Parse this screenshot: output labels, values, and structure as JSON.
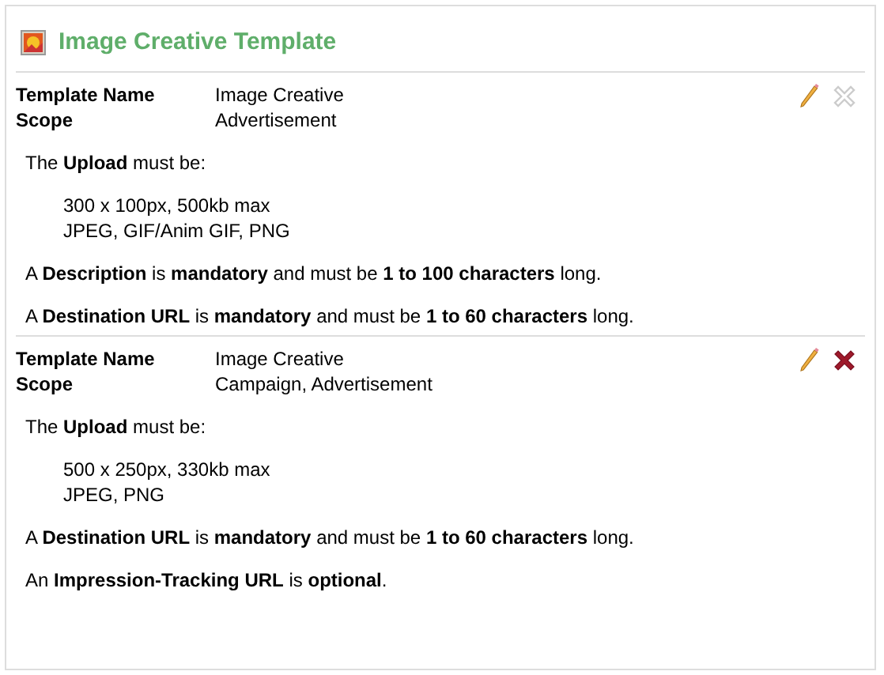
{
  "title": "Image Creative Template",
  "templates": [
    {
      "fields": [
        {
          "label": "Template Name",
          "value": "Image Creative"
        },
        {
          "label": "Scope",
          "value": "Advertisement"
        }
      ],
      "delete_disabled": true,
      "rules": [
        {
          "kind": "list",
          "intro": "The **Upload** must be:",
          "lines": [
            "300 x 100px, 500kb max",
            "JPEG, GIF/Anim GIF, PNG"
          ]
        },
        {
          "kind": "text",
          "text": "A **Description** is **mandatory** and must be **1 to 100 characters** long."
        },
        {
          "kind": "text",
          "text": "A **Destination URL** is **mandatory** and must be **1 to 60 characters** long."
        }
      ]
    },
    {
      "fields": [
        {
          "label": "Template Name",
          "value": "Image Creative"
        },
        {
          "label": "Scope",
          "value": "Campaign, Advertisement"
        }
      ],
      "delete_disabled": false,
      "rules": [
        {
          "kind": "list",
          "intro": "The **Upload** must be:",
          "lines": [
            "500 x 250px, 330kb max",
            "JPEG, PNG"
          ]
        },
        {
          "kind": "text",
          "text": "A **Destination URL** is **mandatory** and must be **1 to 60 characters** long."
        },
        {
          "kind": "text",
          "text": "An **Impression-Tracking URL** is **optional**."
        }
      ]
    }
  ]
}
